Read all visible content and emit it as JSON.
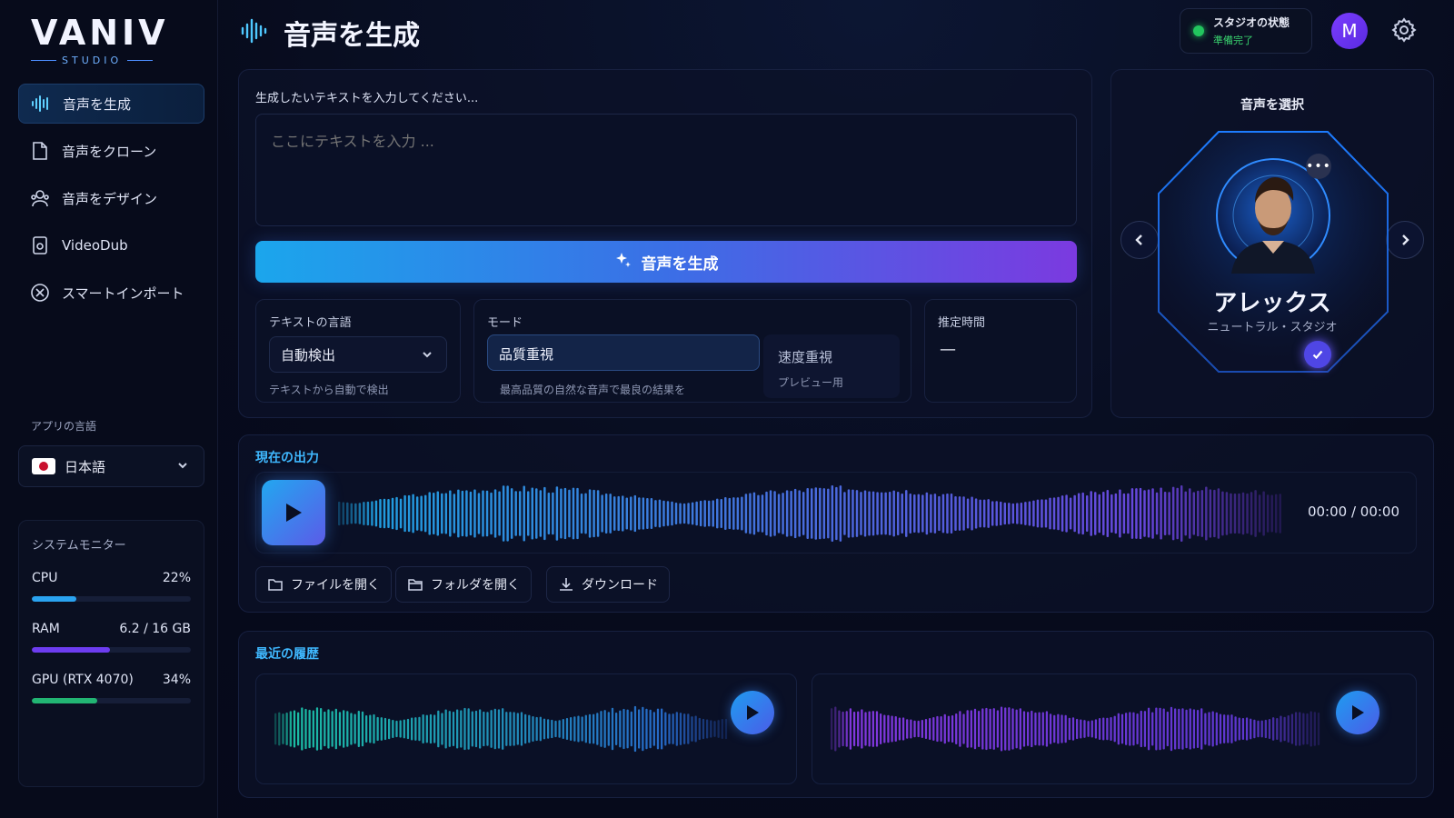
{
  "brand": {
    "name": "VANIV",
    "sub": "STUDIO"
  },
  "sidebar": {
    "items": [
      {
        "label": "音声を生成",
        "icon": "waveform-icon",
        "active": true
      },
      {
        "label": "音声をクローン",
        "icon": "document-icon"
      },
      {
        "label": "音声をデザイン",
        "icon": "users-icon"
      },
      {
        "label": "VideoDub",
        "icon": "video-file-icon"
      },
      {
        "label": "スマートインポート",
        "icon": "x-circle-icon"
      }
    ],
    "app_lang_label": "アプリの言語",
    "app_lang_value": "日本語"
  },
  "sysmon": {
    "title": "システムモニター",
    "metrics": [
      {
        "name": "CPU",
        "value": "22%",
        "level": 0.28,
        "color": "#2aa3f0"
      },
      {
        "name": "RAM",
        "value": "6.2 / 16 GB",
        "level": 0.49,
        "color": "#6d3cf0"
      },
      {
        "name": "GPU (RTX 4070)",
        "value": "34%",
        "level": 0.41,
        "color": "#22b573"
      }
    ]
  },
  "header": {
    "title": "音声を生成",
    "status_label": "スタジオの状態",
    "status_value": "準備完了",
    "avatar_initial": "M"
  },
  "input": {
    "label": "生成したいテキストを入力してください...",
    "placeholder": "ここにテキストを入力 ...",
    "generate_label": "音声を生成"
  },
  "language": {
    "label": "テキストの言語",
    "value": "自動検出",
    "hint": "テキストから自動で検出"
  },
  "mode": {
    "label": "モード",
    "options": [
      {
        "title": "品質重視",
        "desc": "最高品質の自然な音声で最良の結果を"
      },
      {
        "title": "速度重視",
        "desc": "プレビュー用"
      }
    ]
  },
  "estimate": {
    "label": "推定時間",
    "value": "—"
  },
  "voice": {
    "title": "音声を選択",
    "name": "アレックス",
    "sub": "ニュートラル・スタジオ"
  },
  "output": {
    "title": "現在の出力",
    "time": "00:00 / 00:00",
    "buttons": [
      "ファイルを開く",
      "フォルダを開く",
      "ダウンロード"
    ]
  },
  "history": {
    "title": "最近の履歴"
  },
  "colors": {
    "accent_cyan": "#3fb8ff",
    "accent_purple": "#7b3ae0",
    "status_green": "#22c55e"
  }
}
